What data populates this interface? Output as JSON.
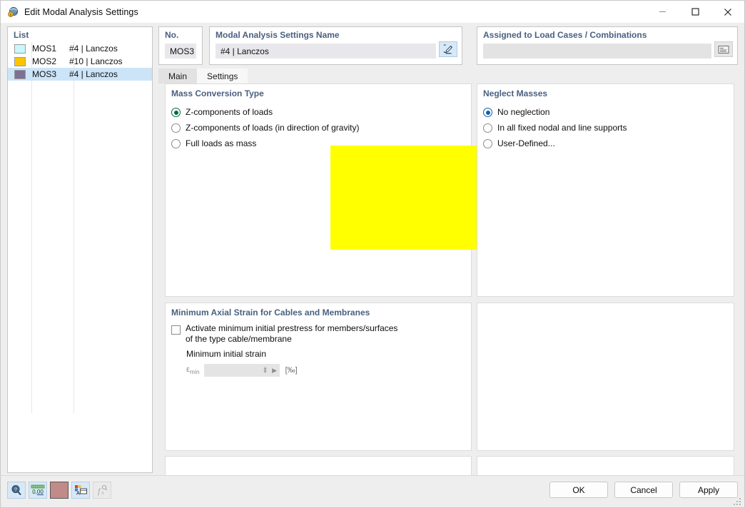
{
  "window": {
    "title": "Edit Modal Analysis Settings",
    "icon": "modal-analysis-icon",
    "controls": {
      "minimize": "minimize-icon",
      "maximize": "maximize-icon",
      "close": "close-icon"
    }
  },
  "list": {
    "header": "List",
    "rows": [
      {
        "no": "MOS1",
        "desc": "#4 | Lanczos",
        "color": "#c9f7fb",
        "selected": false
      },
      {
        "no": "MOS2",
        "desc": "#10 | Lanczos",
        "color": "#fdc400",
        "selected": false
      },
      {
        "no": "MOS3",
        "desc": "#4 | Lanczos",
        "color": "#7d7095",
        "selected": true
      }
    ],
    "toolbar": [
      {
        "name": "new-item-button",
        "icon": "new-window-icon"
      },
      {
        "name": "copy-item-button",
        "icon": "copy-windows-icon"
      },
      {
        "name": "check-all-button",
        "icon": "checklist-check-icon"
      },
      {
        "name": "toggle-check-button",
        "icon": "checklist-refresh-icon"
      },
      {
        "name": "delete-item-button",
        "icon": "red-x-icon",
        "glyph": "✕"
      }
    ]
  },
  "header_fields": {
    "no_label": "No.",
    "no_value": "MOS3",
    "name_label": "Modal Analysis Settings Name",
    "name_value": "#4 | Lanczos",
    "name_edit_icon": "edit-pencil-icon",
    "assigned_label": "Assigned to Load Cases / Combinations",
    "assigned_value": "",
    "assigned_icon": "list-select-icon"
  },
  "tabs": [
    {
      "label": "Main",
      "active": false
    },
    {
      "label": "Settings",
      "active": true
    }
  ],
  "mass_conversion": {
    "title": "Mass Conversion Type",
    "highlighted": true,
    "highlight_color": "#ffff00",
    "selected_color": "#006b3c",
    "options": [
      {
        "label": "Z-components of loads",
        "selected": true
      },
      {
        "label": "Z-components of loads (in direction of gravity)",
        "selected": false
      },
      {
        "label": "Full loads as mass",
        "selected": false
      }
    ]
  },
  "neglect_masses": {
    "title": "Neglect Masses",
    "selected_color": "#1260a8",
    "options": [
      {
        "label": "No neglection",
        "selected": true
      },
      {
        "label": "In all fixed nodal and line supports",
        "selected": false
      },
      {
        "label": "User-Defined...",
        "selected": false
      }
    ]
  },
  "min_axial_strain": {
    "title": "Minimum Axial Strain for Cables and Membranes",
    "checkbox_label_line1": "Activate minimum initial prestress for members/surfaces",
    "checkbox_label_line2": "of the type cable/membrane",
    "checked": false,
    "sub_label": "Minimum initial strain",
    "field_symbol": "ε",
    "field_symbol_sub": "min",
    "field_value": "",
    "unit": "[‰]"
  },
  "footer": {
    "status_icons": [
      {
        "name": "help-search-icon",
        "disabled": false
      },
      {
        "name": "decimal-places-icon",
        "disabled": false,
        "text": "0,00"
      },
      {
        "name": "color-swatch-icon",
        "disabled": false,
        "color": "#c08b88"
      },
      {
        "name": "display-properties-icon",
        "disabled": false
      },
      {
        "name": "formula-function-icon",
        "disabled": true,
        "text": "fₓ"
      }
    ],
    "buttons": [
      {
        "label": "OK",
        "name": "ok-button"
      },
      {
        "label": "Cancel",
        "name": "cancel-button"
      },
      {
        "label": "Apply",
        "name": "apply-button"
      }
    ]
  }
}
